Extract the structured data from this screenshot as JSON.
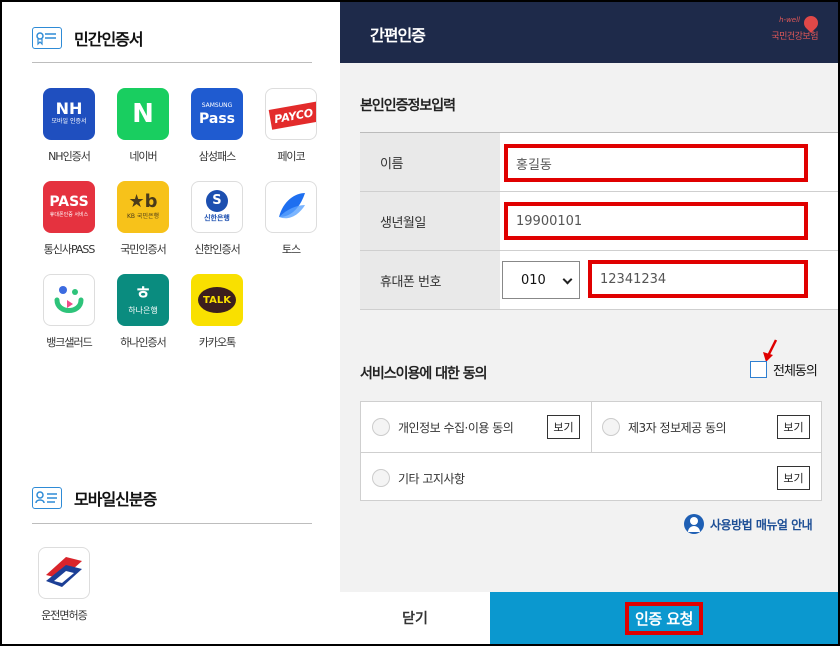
{
  "left": {
    "section1_title": "민간인증서",
    "section2_title": "모바일신분증",
    "apps": [
      {
        "name": "NH인증서",
        "logo_text": "NH",
        "logo_sub": "모바일 인증서",
        "bg": "#1f4fbf"
      },
      {
        "name": "네이버",
        "logo_text": "N",
        "bg": "#19ce60"
      },
      {
        "name": "삼성패스",
        "logo_text": "Pass",
        "logo_sub": "SAMSUNG",
        "bg": "#1f5bd0"
      },
      {
        "name": "페이코",
        "logo_text": "PAYCO",
        "bg": "#ffffff",
        "accent": "#e32b2b"
      },
      {
        "name": "통신사PASS",
        "logo_text": "PASS",
        "logo_sub": "휴대폰인증 서비스",
        "bg": "#e5323f"
      },
      {
        "name": "국민인증서",
        "logo_text": "KB 국민은행",
        "bg": "#f7c21a"
      },
      {
        "name": "신한인증서",
        "logo_text": "신한은행",
        "bg": "#ffffff",
        "accent": "#1c4fb0"
      },
      {
        "name": "토스",
        "logo_text": "",
        "bg": "#ffffff",
        "accent": "#1e6ff0"
      },
      {
        "name": "뱅크샐러드",
        "logo_text": "",
        "bg": "#ffffff",
        "accent": "#2ec37a"
      },
      {
        "name": "하나인증서",
        "logo_text": "하나은행",
        "bg": "#0a8c7f"
      },
      {
        "name": "카카오톡",
        "logo_text": "TALK",
        "bg": "#f9e000"
      }
    ],
    "mobile_id": {
      "name": "운전면허증"
    }
  },
  "right": {
    "header_title": "간편인증",
    "brand_small": "h-well",
    "brand_name": "국민건강보험",
    "form_title": "본인인증정보입력",
    "fields": {
      "name_label": "이름",
      "name_value": "홍길동",
      "birth_label": "생년월일",
      "birth_value": "19900101",
      "phone_label": "휴대폰 번호",
      "phone_prefix": "010",
      "phone_value": "12341234"
    },
    "agree": {
      "title": "서비스이용에 대한 동의",
      "all_label": "전체동의",
      "items": [
        {
          "label": "개인정보 수집·이용 동의",
          "view": "보기"
        },
        {
          "label": "제3자 정보제공 동의",
          "view": "보기"
        },
        {
          "label": "기타 고지사항",
          "view": "보기"
        }
      ]
    },
    "manual_label": "사용방법 매뉴얼 안내",
    "close_label": "닫기",
    "request_label": "인증 요청"
  },
  "colors": {
    "header_bg": "#1e2a4a",
    "request_bg": "#0b98cf",
    "highlight": "#e00000"
  }
}
